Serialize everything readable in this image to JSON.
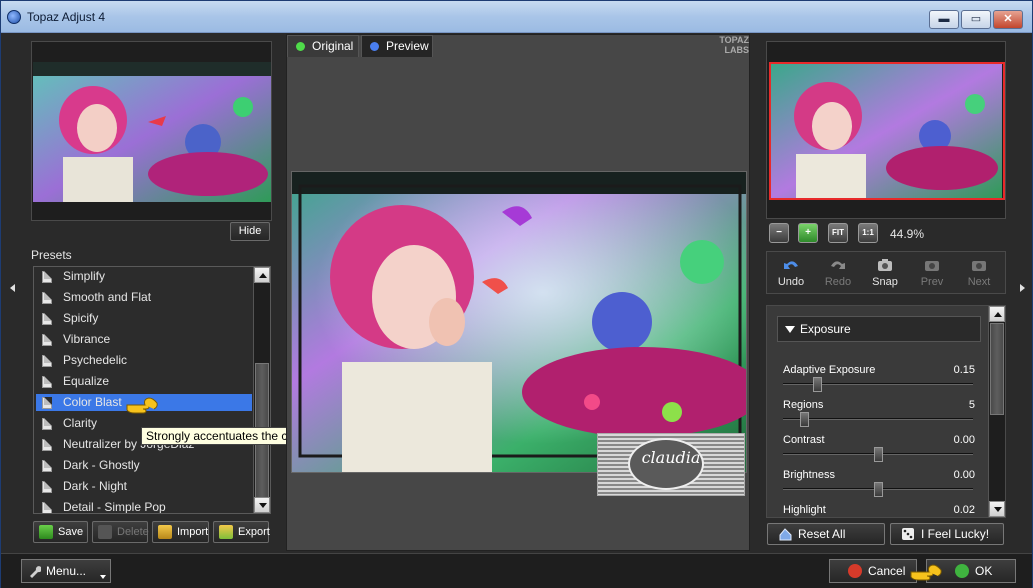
{
  "window": {
    "title": "Topaz Adjust 4",
    "controls": {
      "minimize": "▬",
      "maximize": "▭",
      "close": "✕"
    }
  },
  "left": {
    "hide_label": "Hide",
    "presets_label": "Presets",
    "presets": [
      {
        "label": "Simplify"
      },
      {
        "label": "Smooth and Flat"
      },
      {
        "label": "Spicify"
      },
      {
        "label": "Vibrance"
      },
      {
        "label": "Psychedelic"
      },
      {
        "label": "Equalize"
      },
      {
        "label": "Color Blast",
        "selected": true
      },
      {
        "label": "Clarity"
      },
      {
        "label": "Neutralizer by JorgeDiaz"
      },
      {
        "label": "Dark - Ghostly"
      },
      {
        "label": "Dark - Night"
      },
      {
        "label": "Detail - Simple Pop"
      }
    ],
    "tooltip": "Strongly accentuates the color in the image in a unique way.",
    "buttons": {
      "save": "Save",
      "delete": "Delete",
      "import": "Import",
      "export": "Export"
    }
  },
  "center": {
    "tabs": {
      "original": "Original",
      "preview": "Preview"
    },
    "logo_text": "TOPAZ LABS",
    "watermark_text": "claudia"
  },
  "right": {
    "zoom": {
      "out": "−",
      "in": "+",
      "fit": "FIT",
      "one_to_one": "1:1",
      "level": "44.9%"
    },
    "tools": {
      "undo": "Undo",
      "redo": "Redo",
      "snap": "Snap",
      "prev": "Prev",
      "next": "Next"
    },
    "section_title": "Exposure",
    "sliders": [
      {
        "name": "Adaptive Exposure",
        "value": "0.15",
        "position": 0.18
      },
      {
        "name": "Regions",
        "value": "5",
        "position": 0.11
      },
      {
        "name": "Contrast",
        "value": "0.00",
        "position": 0.5
      },
      {
        "name": "Brightness",
        "value": "0.00",
        "position": 0.5
      },
      {
        "name": "Highlight",
        "value": "0.02",
        "position": 0.52
      }
    ],
    "reset_label": "Reset All",
    "lucky_label": "I Feel Lucky!"
  },
  "status": {
    "menu_label": "Menu...",
    "cancel_label": "Cancel",
    "ok_label": "OK"
  },
  "colors": {
    "selection": "#3b78e7",
    "nav_highlight": "#e82a2a",
    "cancel_icon": "#d63a2a",
    "ok_icon": "#3fb33f"
  },
  "icons": {
    "app": "topaz-app-icon",
    "hand_pointer": "pointing-hand-icon",
    "document": "document-icon"
  }
}
